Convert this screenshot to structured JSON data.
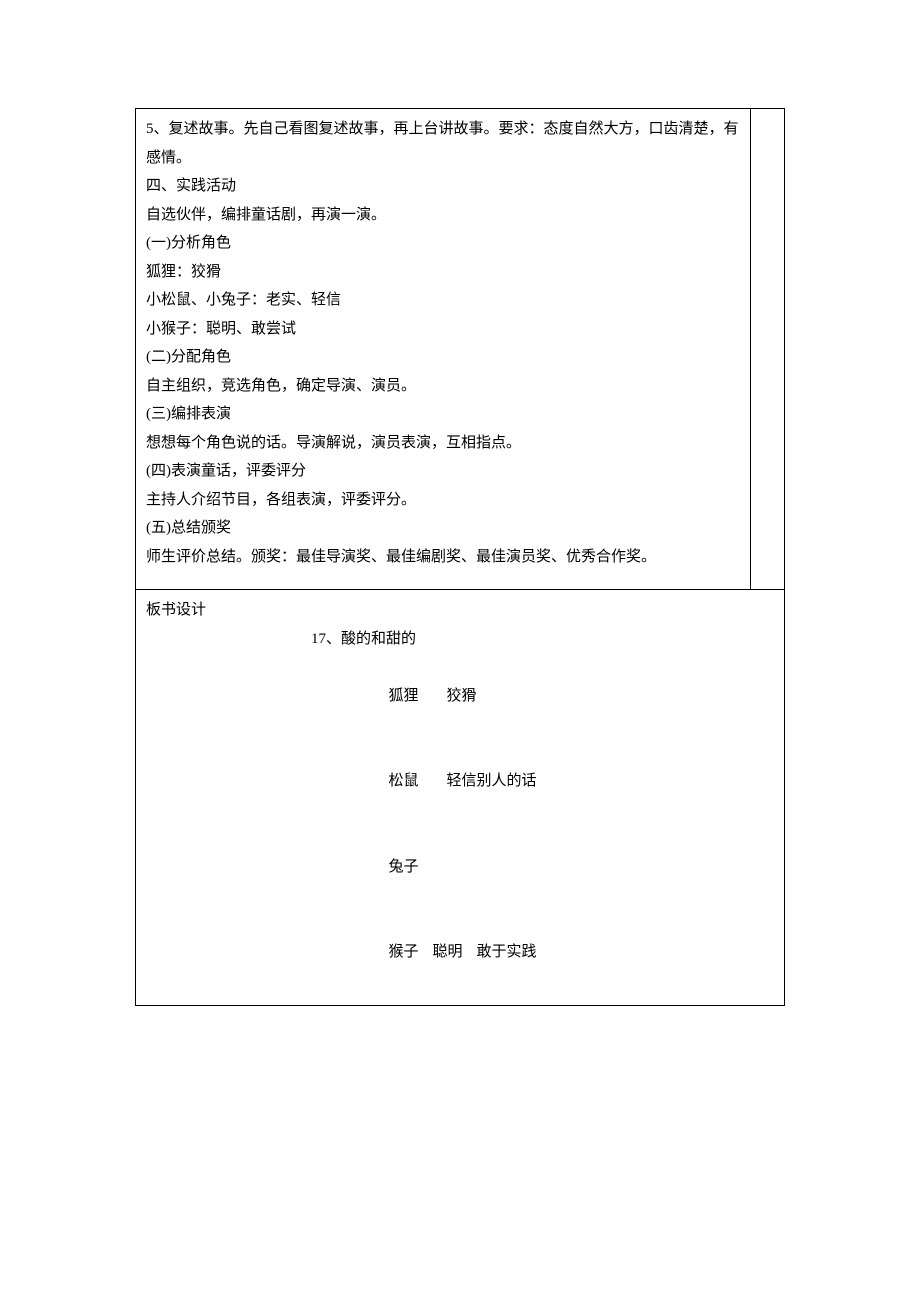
{
  "cell1": {
    "l1": "5、复述故事。先自己看图复述故事，再上台讲故事。要求：态度自然大方，口齿清楚，有感情。",
    "l2": "四、实践活动",
    "l3": "自选伙伴，编排童话剧，再演一演。",
    "l4": "(一)分析角色",
    "l5": "狐狸：狡猾",
    "l6": "小松鼠、小兔子：老实、轻信",
    "l7": "小猴子：聪明、敢尝试",
    "l8": "(二)分配角色",
    "l9": "自主组织，竞选角色，确定导演、演员。",
    "l10": "(三)编排表演",
    "l11": "想想每个角色说的话。导演解说，演员表演，互相指点。",
    "l12": "(四)表演童话，评委评分",
    "l13": "主持人介绍节目，各组表演，评委评分。",
    "l14": "(五)总结颁奖",
    "l15": "师生评价总结。颁奖：最佳导演奖、最佳编剧奖、最佳演员奖、优秀合作奖。"
  },
  "cell2": {
    "heading": "板书设计",
    "title": "17、酸的和甜的",
    "r1a": "狐狸",
    "r1b": "狡猾",
    "r2a": "松鼠",
    "r2b": "轻信别人的话",
    "r3a": "兔子",
    "r4a": "猴子",
    "r4b": "聪明",
    "r4c": "敢于实践"
  }
}
